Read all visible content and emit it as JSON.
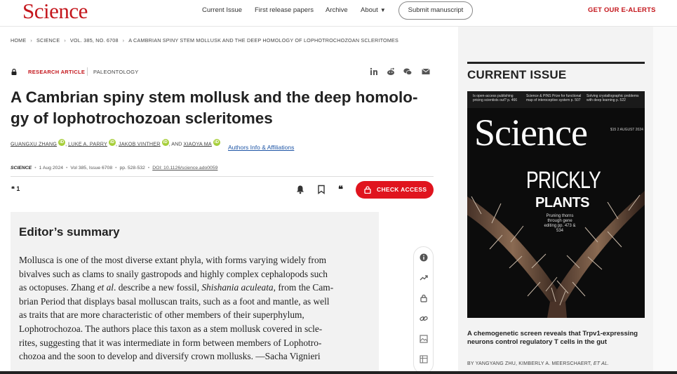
{
  "header": {
    "logo": "Science",
    "nav": [
      "Current Issue",
      "First release papers",
      "Archive",
      "About"
    ],
    "submit_label": "Submit manuscript",
    "ealerts_label": "GET OUR E-ALERTS"
  },
  "breadcrumb": [
    "HOME",
    "SCIENCE",
    "VOL. 385, NO. 6708",
    "A CAMBRIAN SPINY STEM MOLLUSK AND THE DEEP HOMOLOGY OF LOPHOTROCHOZOAN SCLERITOMES"
  ],
  "article": {
    "type": "RESEARCH ARTICLE",
    "subject": "PALEONTOLOGY",
    "title_line1": "A Cambrian spiny stem mollusk and the deep homolo-",
    "title_line2": "gy of lophotrochozoan scleritomes",
    "authors": [
      "GUANGXU ZHANG",
      "LUKE A. PARRY",
      "JAKOB VINTHER",
      "XIAOYA MA"
    ],
    "author_sep": ",",
    "author_and": ", AND",
    "affil_label": "Authors Info & Affiliations",
    "journal": "SCIENCE",
    "date": "1 Aug 2024",
    "volume": "Vol 385, Issue 6708",
    "pages": "pp. 528-532",
    "doi": "DOI: 10.1126/science.ado0059",
    "citations": "1",
    "check_access_label": "CHECK ACCESS"
  },
  "summary": {
    "heading": "Editor’s summary",
    "lines": [
      [
        "Mollusca is one of the most diverse extant phyla, with forms varying widely from",
        "",
        "",
        "",
        ""
      ],
      [
        "bivalves such as clams to snaily gastropods and highly complex cephalopods such",
        "",
        "",
        "",
        ""
      ],
      [
        "as octopuses. Zhang ",
        "et al",
        ". describe a new fossil, ",
        "Shishania aculeata",
        ", from the Cam-"
      ],
      [
        "brian Period that displays basal molluscan traits, such as a foot and mantle, as well",
        "",
        "",
        "",
        ""
      ],
      [
        "as traits that are more characteristic of other members of their superphylum,",
        "",
        "",
        "",
        ""
      ],
      [
        "Lophotrochozoa. The authors place this taxon as a stem mollusk covered in scle-",
        "",
        "",
        "",
        ""
      ],
      [
        "rites, suggesting that it was intermediate in form between members of Lophotro-",
        "",
        "",
        "",
        ""
      ],
      [
        "chozoa and the soon to develop and diversify crown mollusks. —Sacha Vignieri",
        "",
        "",
        "",
        ""
      ]
    ]
  },
  "sidebar": {
    "heading": "CURRENT ISSUE",
    "cover": {
      "top_items": [
        "Is open-access publishing pricing scientists out? p. 466",
        "Science & PINS Prize for functional map of interoceptive system p. 507",
        "Solving crystallographic problems with deep learning p. 522"
      ],
      "logo": "Science",
      "date": "$15 2 AUGUST 2024",
      "headline1": "PRICKLY",
      "headline2": "PLANTS",
      "subline": "Pruning thorns through gene editing pp. 473 & 534"
    },
    "article_title": "A chemogenetic screen reveals that Trpv1-expressing neurons control regulatory T cells in the gut",
    "article_authors": "BY YANGYANG ZHU, KIMBERLY A. MEERSCHAERT,",
    "article_etal": "ET AL."
  },
  "icons": {
    "share": [
      "linkedin-icon",
      "reddit-icon",
      "wechat-icon",
      "email-icon"
    ],
    "tools": [
      "bell-icon",
      "bookmark-icon",
      "quote-icon"
    ],
    "rail": [
      "info-icon",
      "trending-icon",
      "lock-icon",
      "link-icon",
      "gallery-icon",
      "table-icon"
    ]
  },
  "colors": {
    "brand_red": "#c4161c",
    "button_red": "#e0141e",
    "link_blue": "#1f56a6",
    "orcid_green": "#a6ce39"
  }
}
